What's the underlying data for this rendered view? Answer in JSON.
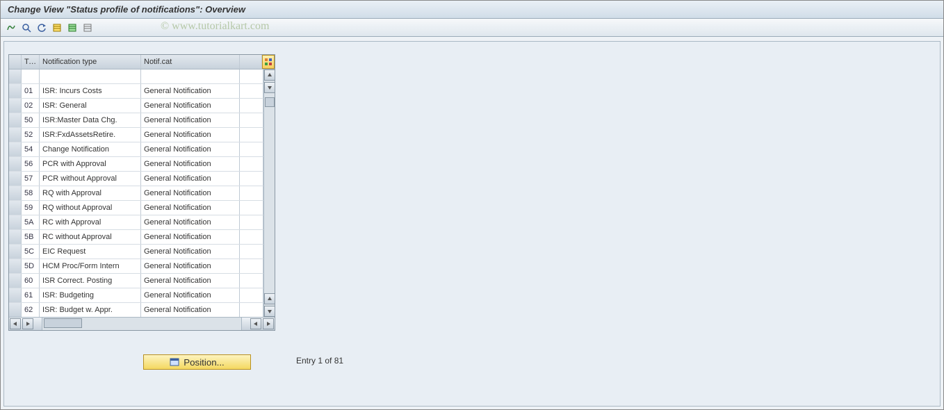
{
  "title": "Change View \"Status profile of notifications\": Overview",
  "watermark": "© www.tutorialkart.com",
  "toolbar": {
    "icons": [
      "other-view",
      "find",
      "undo",
      "select-all",
      "deselect-all",
      "new-entries"
    ]
  },
  "table": {
    "headers": {
      "typ": "Typ",
      "ntyp": "Notification type",
      "cat": "Notif.cat"
    },
    "rows": [
      {
        "typ": "",
        "ntyp": "",
        "cat": ""
      },
      {
        "typ": "01",
        "ntyp": "ISR: Incurs Costs",
        "cat": "General Notification"
      },
      {
        "typ": "02",
        "ntyp": "ISR: General",
        "cat": "General Notification"
      },
      {
        "typ": "50",
        "ntyp": "ISR:Master Data Chg.",
        "cat": "General Notification"
      },
      {
        "typ": "52",
        "ntyp": "ISR:FxdAssetsRetire.",
        "cat": "General Notification"
      },
      {
        "typ": "54",
        "ntyp": "Change Notification",
        "cat": "General Notification"
      },
      {
        "typ": "56",
        "ntyp": "PCR with Approval",
        "cat": "General Notification"
      },
      {
        "typ": "57",
        "ntyp": "PCR without Approval",
        "cat": "General Notification"
      },
      {
        "typ": "58",
        "ntyp": "RQ with Approval",
        "cat": "General Notification"
      },
      {
        "typ": "59",
        "ntyp": "RQ without Approval",
        "cat": "General Notification"
      },
      {
        "typ": "5A",
        "ntyp": "RC with Approval",
        "cat": "General Notification"
      },
      {
        "typ": "5B",
        "ntyp": "RC without Approval",
        "cat": "General Notification"
      },
      {
        "typ": "5C",
        "ntyp": "EIC Request",
        "cat": "General Notification"
      },
      {
        "typ": "5D",
        "ntyp": "HCM Proc/Form Intern",
        "cat": "General Notification"
      },
      {
        "typ": "60",
        "ntyp": "ISR Correct. Posting",
        "cat": "General Notification"
      },
      {
        "typ": "61",
        "ntyp": "ISR: Budgeting",
        "cat": "General Notification"
      },
      {
        "typ": "62",
        "ntyp": "ISR: Budget w. Appr.",
        "cat": "General Notification"
      }
    ]
  },
  "position_button": "Position...",
  "entry_status": "Entry 1 of 81"
}
